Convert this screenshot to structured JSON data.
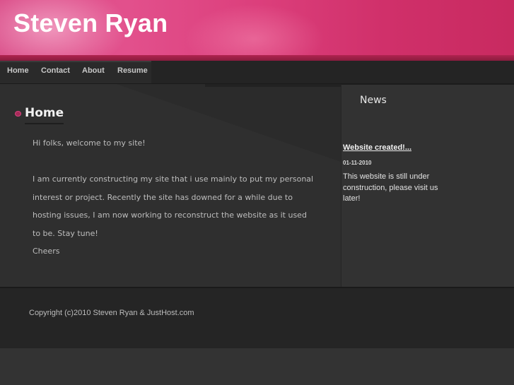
{
  "header": {
    "site_title": "Steven Ryan"
  },
  "nav": {
    "items": [
      {
        "label": "Home"
      },
      {
        "label": "Contact"
      },
      {
        "label": "About"
      },
      {
        "label": "Resume"
      }
    ]
  },
  "main": {
    "heading": "Home",
    "paragraphs": [
      "Hi folks, welcome to my site!",
      "I am currently constructing my site that i use mainly to put my personal interest or project. Recently the site has downed for a while due to hosting issues, I am now working to reconstruct the website as it used to be. Stay tune!",
      "Cheers"
    ]
  },
  "sidebar": {
    "title": "News",
    "news": [
      {
        "headline": "Website created!...",
        "date": "01-11-2010",
        "body": "This website is still under construction, please visit us later!"
      }
    ]
  },
  "footer": {
    "copyright": "Copyright (c)2010 Steven Ryan & JustHost.com"
  },
  "colors": {
    "header_pink": "#dc3f7c",
    "background": "#323232",
    "content_panel": "#2b2b2b",
    "footer": "#252525",
    "accent": "#d9447f"
  },
  "icons": {
    "heading_bullet": "pink-bullet-icon"
  }
}
